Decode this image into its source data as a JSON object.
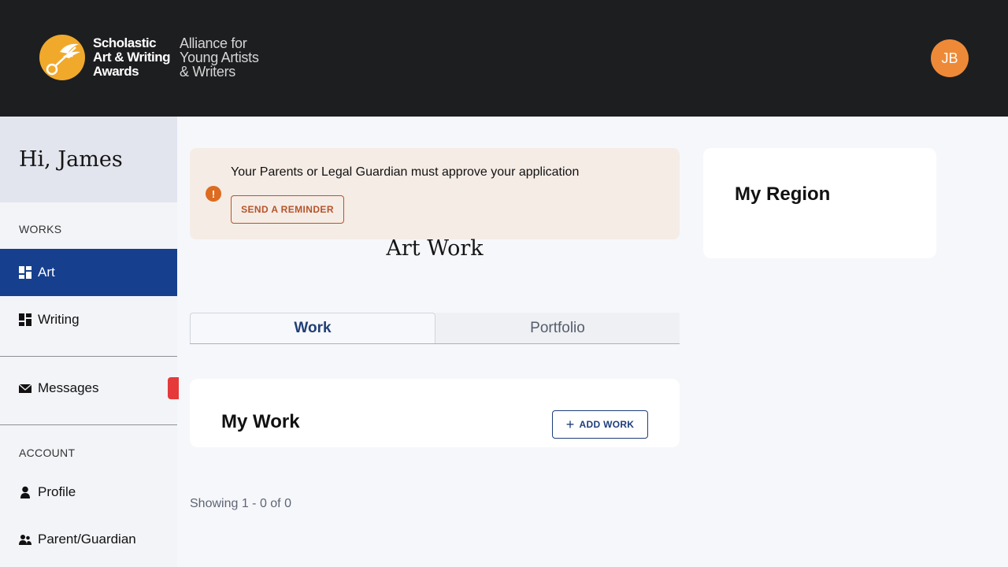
{
  "header": {
    "logo_lines": [
      "Scholastic",
      "Art & Writing",
      "Awards"
    ],
    "logo_sub_lines": [
      "Alliance for",
      "Young Artists",
      "& Writers"
    ],
    "avatar_initials": "JB",
    "brand_color": "#f1a92c"
  },
  "sidebar": {
    "greeting": "Hi, James",
    "works_label": "WORKS",
    "items": [
      {
        "label": "Art",
        "icon": "dashboard-icon",
        "active": true
      },
      {
        "label": "Writing",
        "icon": "dashboard-icon",
        "active": false
      },
      {
        "label": "Messages",
        "icon": "envelope-icon",
        "active": false
      },
      {
        "label": "Profile",
        "icon": "user-icon",
        "active": false
      },
      {
        "label": "Parent/Guardian",
        "icon": "users-icon",
        "active": false
      }
    ],
    "account_label": "ACCOUNT",
    "active_color": "#163f8e"
  },
  "alert": {
    "message": "Your Parents or Legal Guardian must approve your application",
    "button_label": "SEND A REMINDER"
  },
  "main": {
    "page_title": "Art Work",
    "tabs": [
      {
        "label": "Work",
        "active": true
      },
      {
        "label": "Portfolio",
        "active": false
      }
    ],
    "my_work_title": "My Work",
    "add_work_label": "ADD WORK",
    "showing_text": "Showing 1 - 0 of 0"
  },
  "region": {
    "title": "My Region"
  }
}
